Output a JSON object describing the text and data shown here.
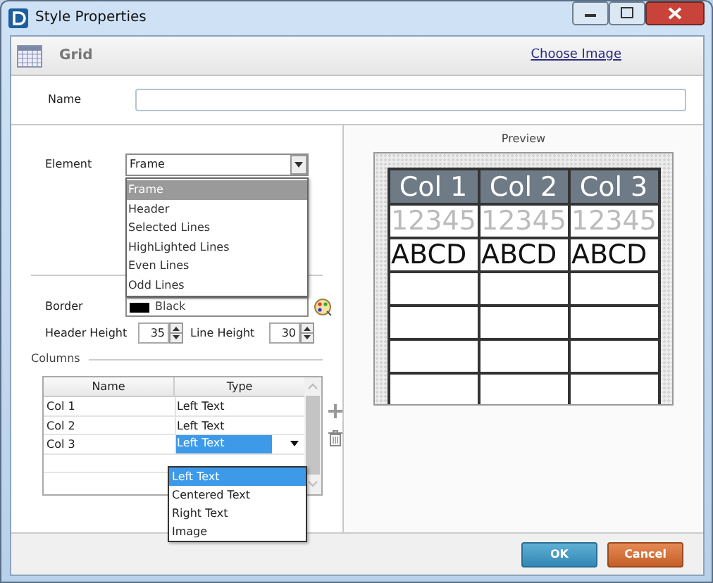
{
  "window": {
    "title": "Style Properties"
  },
  "header": {
    "title": "Grid",
    "link": "Choose Image"
  },
  "name_field": {
    "label": "Name"
  },
  "element": {
    "label": "Element",
    "value": "Frame",
    "options": [
      {
        "label": "Frame",
        "selected": true
      },
      {
        "label": "Header",
        "selected": false
      },
      {
        "label": "Selected Lines",
        "selected": false
      },
      {
        "label": "HighLighted Lines",
        "selected": false
      },
      {
        "label": "Even Lines",
        "selected": false
      },
      {
        "label": "Odd Lines",
        "selected": false
      }
    ]
  },
  "border": {
    "label": "Border",
    "value": "Black",
    "color": "#000000"
  },
  "header_height": {
    "label": "Header Height",
    "value": "35"
  },
  "line_height": {
    "label": "Line Height",
    "value": "30"
  },
  "columns": {
    "title": "Columns",
    "headers": [
      "Name",
      "Type"
    ],
    "rows": [
      {
        "name": "Col 1",
        "type": "Left Text",
        "selected": false
      },
      {
        "name": "Col 2",
        "type": "Left Text",
        "selected": false
      },
      {
        "name": "Col 3",
        "type": "Left Text",
        "selected": true
      }
    ],
    "type_options": [
      {
        "label": "Left Text",
        "selected": true
      },
      {
        "label": "Centered Text",
        "selected": false
      },
      {
        "label": "Right Text",
        "selected": false
      },
      {
        "label": "Image",
        "selected": false
      }
    ]
  },
  "preview": {
    "title": "Preview",
    "columns": [
      "Col 1",
      "Col 2",
      "Col 3"
    ],
    "rows": [
      {
        "kind": "faded",
        "cells": [
          "12345",
          "12345",
          "12345"
        ]
      },
      {
        "kind": "normal",
        "cells": [
          "ABCD",
          "ABCD",
          "ABCD"
        ]
      }
    ]
  },
  "buttons": [
    {
      "label": "OK",
      "kind": "primary"
    },
    {
      "label": "Cancel",
      "kind": "secondary"
    }
  ]
}
